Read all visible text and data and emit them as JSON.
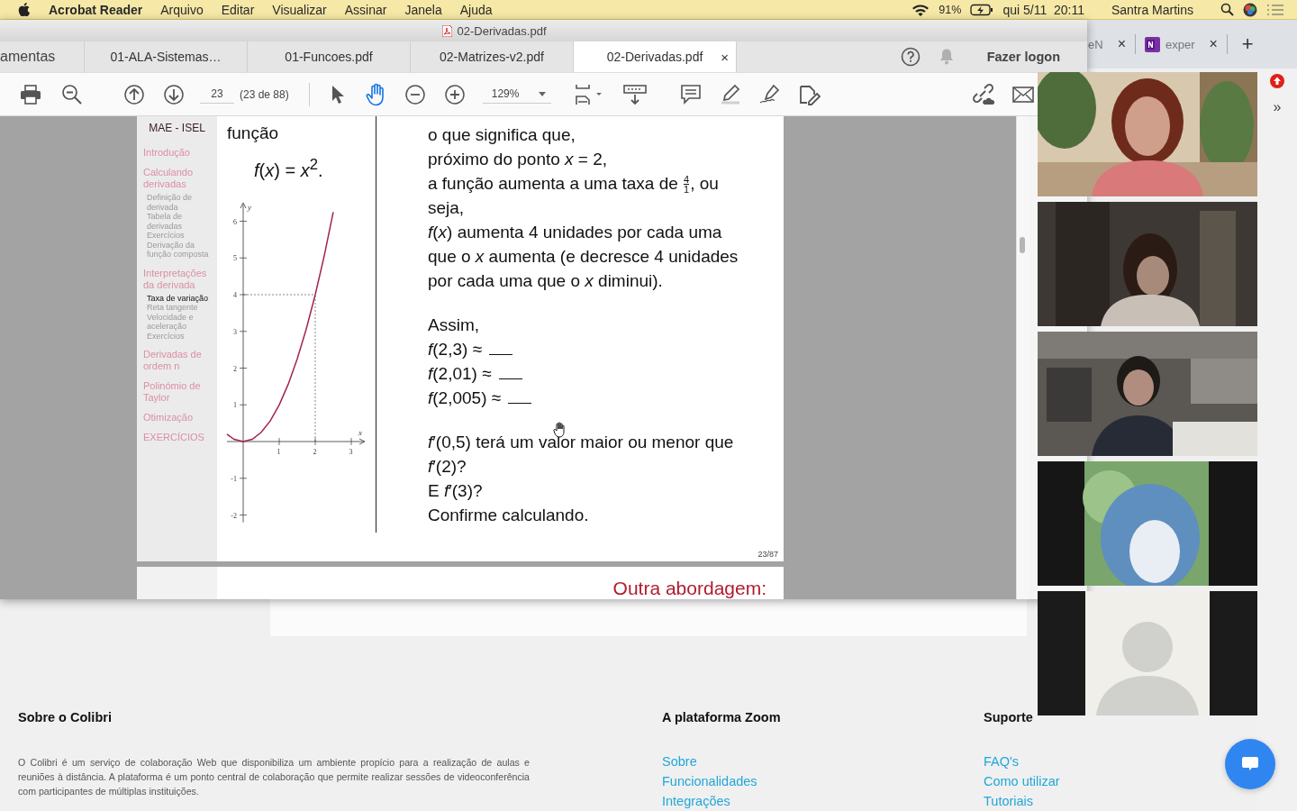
{
  "menubar": {
    "app": "Acrobat Reader",
    "menus": [
      "Arquivo",
      "Editar",
      "Visualizar",
      "Assinar",
      "Janela",
      "Ajuda"
    ],
    "battery": "91%",
    "clock": "qui 5/11  20:11",
    "user": "Santra Martins"
  },
  "browser": {
    "tabs": [
      {
        "label": "eN",
        "kind": "plain",
        "close": "×"
      },
      {
        "label": "exper",
        "kind": "onenote",
        "close": "×"
      }
    ],
    "new_tab": "+",
    "overflow": "»",
    "footer": [
      {
        "heading": "Sobre o Colibri",
        "text": "O Colibri é um serviço de colaboração Web que disponibiliza um ambiente propício para a realização de aulas e reuniões à distância. A plataforma é um ponto central de colaboração que permite realizar sessões de videoconferência com participantes de múltiplas instituições."
      },
      {
        "heading": "A plataforma Zoom",
        "links": [
          "Sobre",
          "Funcionalidades",
          "Integrações"
        ]
      },
      {
        "heading": "Suporte",
        "links": [
          "FAQ's",
          "Como utilizar",
          "Tutoriais"
        ]
      }
    ]
  },
  "acrobat": {
    "window_title": "02-Derivadas.pdf",
    "tools_tab": "amentas",
    "tabs": [
      {
        "label": "01-ALA-Sistemas…",
        "selected": false
      },
      {
        "label": "01-Funcoes.pdf",
        "selected": false
      },
      {
        "label": "02-Matrizes-v2.pdf",
        "selected": false
      },
      {
        "label": "02-Derivadas.pdf",
        "selected": true,
        "close": "×"
      }
    ],
    "login": "Fazer logon",
    "page": "23",
    "page_count": "(23 de 88)",
    "zoom": "129%",
    "tools": [
      {
        "kind": "select",
        "selected": false
      },
      {
        "kind": "hand",
        "selected": true
      }
    ],
    "slide": {
      "header": "MAE - ISEL",
      "nav": [
        {
          "label": "Introdução",
          "selected": false
        },
        {
          "label": "Calculando derivadas",
          "selected": false,
          "children": [
            {
              "label": "Definição de derivada",
              "selected": false
            },
            {
              "label": "Tabela de derivadas",
              "selected": false
            },
            {
              "label": "Exercícios",
              "selected": false
            },
            {
              "label": "Derivação da função composta",
              "selected": false
            }
          ]
        },
        {
          "label": "Interpretações da derivada",
          "selected": false,
          "children": [
            {
              "label": "Taxa de variação",
              "selected": true
            },
            {
              "label": "Reta tangente",
              "selected": false
            },
            {
              "label": "Velocidade e aceleração",
              "selected": false
            },
            {
              "label": "Exercícios",
              "selected": false
            }
          ]
        },
        {
          "label": "Derivadas de ordem n",
          "selected": false
        },
        {
          "label": "Polinómio de Taylor",
          "selected": false
        },
        {
          "label": "Otimização",
          "selected": false
        },
        {
          "label": "EXERCÍCIOS",
          "selected": false
        }
      ],
      "heading": "função",
      "formula": "*f*(*x*) = *x*$^{2}$.",
      "chart_data": {
        "type": "line",
        "xlabel": "x",
        "ylabel": "y",
        "x": [
          -0.45,
          -0.25,
          0,
          0.25,
          0.5,
          0.75,
          1,
          1.25,
          1.5,
          1.75,
          2,
          2.25,
          2.5
        ],
        "xlim": [
          -0.45,
          3.35
        ],
        "ylim": [
          -2.2,
          6.45
        ],
        "series": [
          {
            "color": "#a3234f",
            "values": [
              0.2,
              0.06,
              0,
              0.06,
              0.25,
              0.56,
              1,
              1.56,
              2.25,
              3.06,
              4,
              5.06,
              6.25
            ]
          }
        ],
        "xticks": [
          {
            "value": 1,
            "label": "1"
          },
          {
            "value": 2,
            "label": "2"
          },
          {
            "value": 3,
            "label": "3"
          }
        ],
        "yticks": [
          {
            "value": -2,
            "label": "-2"
          },
          {
            "value": -1,
            "label": "-1"
          },
          {
            "value": 1,
            "label": "1"
          },
          {
            "value": 2,
            "label": "2"
          },
          {
            "value": 3,
            "label": "3"
          },
          {
            "value": 4,
            "label": "4"
          },
          {
            "value": 5,
            "label": "5"
          },
          {
            "value": 6,
            "label": "6"
          }
        ],
        "ref_lines": [
          {
            "axis": "y",
            "value": 4
          },
          {
            "axis": "x",
            "value": 2
          }
        ]
      },
      "paragraphs": [
        [
          {
            "kind": "text",
            "text": "o que significa que,"
          },
          {
            "kind": "text",
            "text": "próximo do ponto *x* = 2,"
          },
          {
            "kind": "fraction",
            "text": "a função aumenta a uma taxa de ",
            "num": "4",
            "den": "1",
            "after": ", ou"
          },
          {
            "kind": "text",
            "text": "seja,"
          },
          {
            "kind": "text",
            "text": "*f*(*x*) aumenta 4 unidades por cada uma"
          },
          {
            "kind": "text",
            "text": "que o *x* aumenta (e decresce 4 unidades"
          },
          {
            "kind": "text",
            "text": "por cada uma que o *x* diminui)."
          }
        ],
        [
          {
            "kind": "text",
            "text": "Assim,"
          },
          {
            "kind": "blank",
            "text": "*f*(2,3) ≈"
          },
          {
            "kind": "blank",
            "text": "*f*(2,01) ≈"
          },
          {
            "kind": "blank",
            "text": "*f*(2,005) ≈"
          }
        ],
        [
          {
            "kind": "text",
            "text": "*f*′(0,5) terá um valor maior ou menor que"
          },
          {
            "kind": "text",
            "text": "*f*′(2)?"
          },
          {
            "kind": "text",
            "text": "E *f*′(3)?"
          },
          {
            "kind": "text",
            "text": "Confirme calculando."
          }
        ]
      ],
      "page_number": "23/87",
      "next_title": "Outra abordagem:"
    }
  },
  "videos": [
    {
      "kind": "picture"
    },
    {
      "kind": "picture"
    },
    {
      "kind": "picture"
    },
    {
      "kind": "picture"
    },
    {
      "kind": "avatar"
    }
  ]
}
